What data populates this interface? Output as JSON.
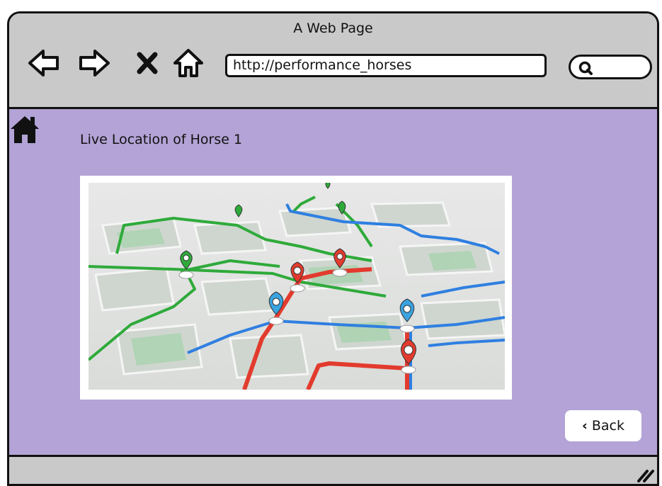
{
  "window": {
    "title": "A Web Page"
  },
  "browser": {
    "url": "http://performance_horses"
  },
  "page": {
    "heading": "Live Location of Horse 1",
    "back_label": "Back"
  },
  "icons": [
    "back-arrow-icon",
    "forward-arrow-icon",
    "close-icon",
    "home-icon",
    "search-icon",
    "home-icon",
    "chevron-left-icon",
    "resize-grip-icon"
  ],
  "colors": {
    "content_bg": "#b3a3d6",
    "chrome_bg": "#c9c9c9",
    "route_green": "#2eaa3a",
    "route_blue": "#2f7fe0",
    "route_red": "#e23b2e"
  }
}
